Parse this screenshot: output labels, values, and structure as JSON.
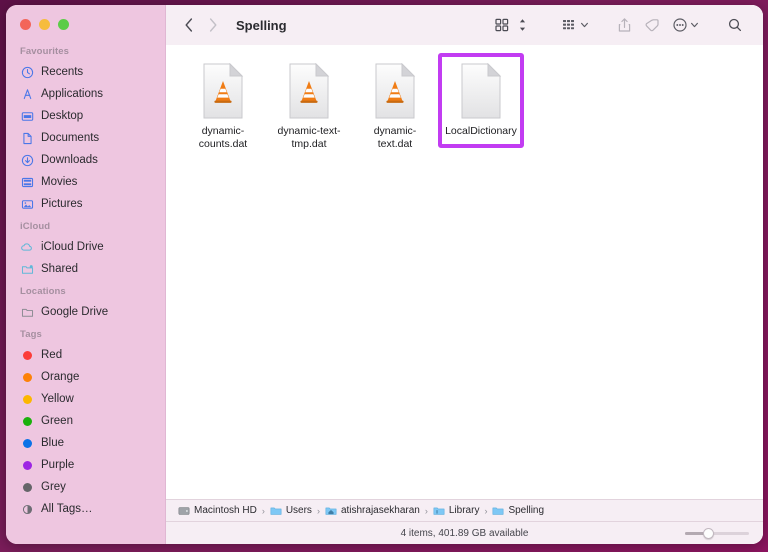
{
  "window": {
    "title": "Spelling",
    "traffic_lights": [
      {
        "name": "close",
        "color": "#f3655a"
      },
      {
        "name": "minimize",
        "color": "#f6bc3d"
      },
      {
        "name": "maximize",
        "color": "#5ccc48"
      }
    ]
  },
  "toolbar": {
    "back_label": "‹",
    "forward_label": "›",
    "items": [
      {
        "name": "view-grid-button",
        "icon": "grid-view-icon"
      },
      {
        "name": "view-stepper",
        "icon": "stepper-icon"
      },
      {
        "name": "group-by-button",
        "icon": "group-grid-icon"
      },
      {
        "name": "share-button",
        "icon": "share-icon"
      },
      {
        "name": "tag-button",
        "icon": "tag-icon"
      },
      {
        "name": "more-button",
        "icon": "ellipsis-circle-icon"
      },
      {
        "name": "search-button",
        "icon": "search-icon"
      }
    ]
  },
  "sidebar": {
    "sections": [
      {
        "title": "Favourites",
        "items": [
          {
            "label": "Recents",
            "icon": "clock-icon",
            "color": "#4a77e8"
          },
          {
            "label": "Applications",
            "icon": "applications-icon",
            "color": "#4a77e8"
          },
          {
            "label": "Desktop",
            "icon": "desktop-icon",
            "color": "#4a77e8"
          },
          {
            "label": "Documents",
            "icon": "document-icon",
            "color": "#4a77e8"
          },
          {
            "label": "Downloads",
            "icon": "download-icon",
            "color": "#4a77e8"
          },
          {
            "label": "Movies",
            "icon": "movies-icon",
            "color": "#4a77e8"
          },
          {
            "label": "Pictures",
            "icon": "pictures-icon",
            "color": "#4a77e8"
          }
        ]
      },
      {
        "title": "iCloud",
        "items": [
          {
            "label": "iCloud Drive",
            "icon": "cloud-icon",
            "color": "#5fb8d8"
          },
          {
            "label": "Shared",
            "icon": "shared-folder-icon",
            "color": "#5fb8d8"
          }
        ]
      },
      {
        "title": "Locations",
        "items": [
          {
            "label": "Google Drive",
            "icon": "folder-icon",
            "color": "#8b8b93"
          }
        ]
      },
      {
        "title": "Tags",
        "items": [
          {
            "label": "Red",
            "icon": "tag-dot-icon",
            "color": "#fc3d39"
          },
          {
            "label": "Orange",
            "icon": "tag-dot-icon",
            "color": "#fd8208"
          },
          {
            "label": "Yellow",
            "icon": "tag-dot-icon",
            "color": "#fcb700"
          },
          {
            "label": "Green",
            "icon": "tag-dot-icon",
            "color": "#1bb10d"
          },
          {
            "label": "Blue",
            "icon": "tag-dot-icon",
            "color": "#0b72e7"
          },
          {
            "label": "Purple",
            "icon": "tag-dot-icon",
            "color": "#9d26e3"
          },
          {
            "label": "Grey",
            "icon": "tag-dot-icon",
            "color": "#656569"
          },
          {
            "label": "All Tags…",
            "icon": "all-tags-icon",
            "color": "#6d6d74"
          }
        ]
      }
    ]
  },
  "content": {
    "files": [
      {
        "name": "dynamic-counts.dat",
        "icon": "vlc-document-icon",
        "selected": false
      },
      {
        "name": "dynamic-text-tmp.dat",
        "icon": "vlc-document-icon",
        "selected": false
      },
      {
        "name": "dynamic-text.dat",
        "icon": "vlc-document-icon",
        "selected": false
      },
      {
        "name": "LocalDictionary",
        "icon": "blank-document-icon",
        "selected": true
      }
    ],
    "selection_highlight_color": "#c23cf2"
  },
  "pathbar": {
    "crumbs": [
      {
        "label": "Macintosh HD",
        "icon": "hard-drive-icon"
      },
      {
        "label": "Users",
        "icon": "folder-icon"
      },
      {
        "label": "atishrajasekharan",
        "icon": "home-folder-icon"
      },
      {
        "label": "Library",
        "icon": "folder-icon"
      },
      {
        "label": "Spelling",
        "icon": "folder-icon"
      }
    ],
    "separator": "›"
  },
  "statusbar": {
    "text": "4 items, 401.89 GB available",
    "zoom_slider_value": 30
  }
}
